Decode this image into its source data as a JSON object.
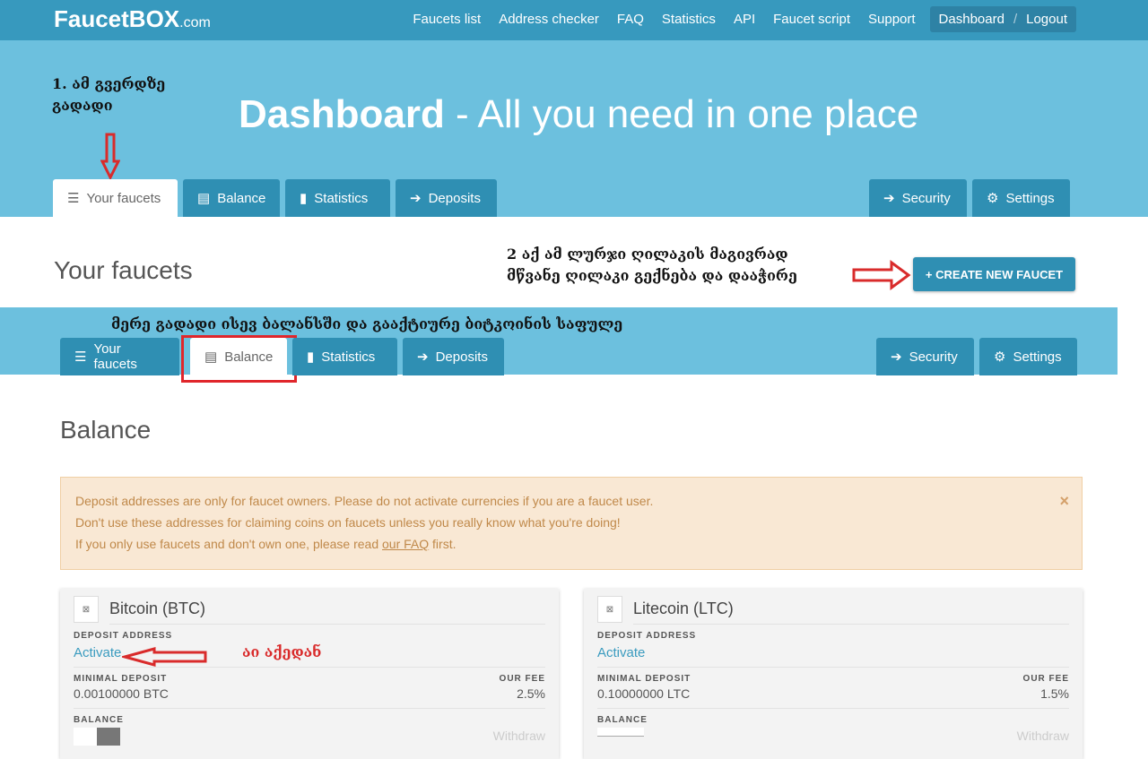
{
  "nav": {
    "logo": "FaucetBOX",
    "logo_suffix": ".com",
    "links": [
      "Faucets list",
      "Address checker",
      "FAQ",
      "Statistics",
      "API",
      "Faucet script",
      "Support"
    ],
    "dashboard": "Dashboard",
    "sep": "/",
    "logout": "Logout"
  },
  "hero": {
    "title_bold": "Dashboard",
    "title_rest": " - All you need in one place"
  },
  "tabs": {
    "your_faucets": "Your faucets",
    "balance": "Balance",
    "statistics": "Statistics",
    "deposits": "Deposits",
    "security": "Security",
    "settings": "Settings"
  },
  "section1": {
    "title": "Your faucets",
    "create_button": "+ CREATE NEW FAUCET"
  },
  "annotations": {
    "a1_line1": "1. ამ გვერდზე",
    "a1_line2": "გადადი",
    "a2_line1": "2 აქ ამ ლურჯი ღილაკის მაგივრად",
    "a2_line2": "მწვანე ღილაკი გექნება და დააჭირე",
    "a3": "მერე გადადი ისევ ბალანსში და გააქტიურე ბიტკოინის საფულე",
    "a4": "აი აქედან"
  },
  "section2": {
    "title": "Balance"
  },
  "alert": {
    "line1": "Deposit addresses are only for faucet owners. Please do not activate currencies if you are a faucet user.",
    "line2": "Don't use these addresses for claiming coins on faucets unless you really know what you're doing!",
    "line3_pre": "If you only use faucets and don't own one, please read ",
    "line3_link": "our FAQ",
    "line3_post": " first.",
    "close": "×"
  },
  "cards": [
    {
      "name": "Bitcoin (BTC)",
      "deposit_label": "DEPOSIT ADDRESS",
      "activate": "Activate",
      "min_label": "MINIMAL DEPOSIT",
      "min_value": "0.00100000 BTC",
      "fee_label": "OUR FEE",
      "fee_value": "2.5%",
      "balance_label": "BALANCE",
      "withdraw": "Withdraw"
    },
    {
      "name": "Litecoin (LTC)",
      "deposit_label": "DEPOSIT ADDRESS",
      "activate": "Activate",
      "min_label": "MINIMAL DEPOSIT",
      "min_value": "0.10000000 LTC",
      "fee_label": "OUR FEE",
      "fee_value": "1.5%",
      "balance_label": "BALANCE",
      "withdraw": "Withdraw"
    }
  ],
  "colors": {
    "nav": "#3799be",
    "hero": "#6cc0de",
    "tab": "#2f8fb3",
    "annotation_red": "#d92b2b"
  }
}
